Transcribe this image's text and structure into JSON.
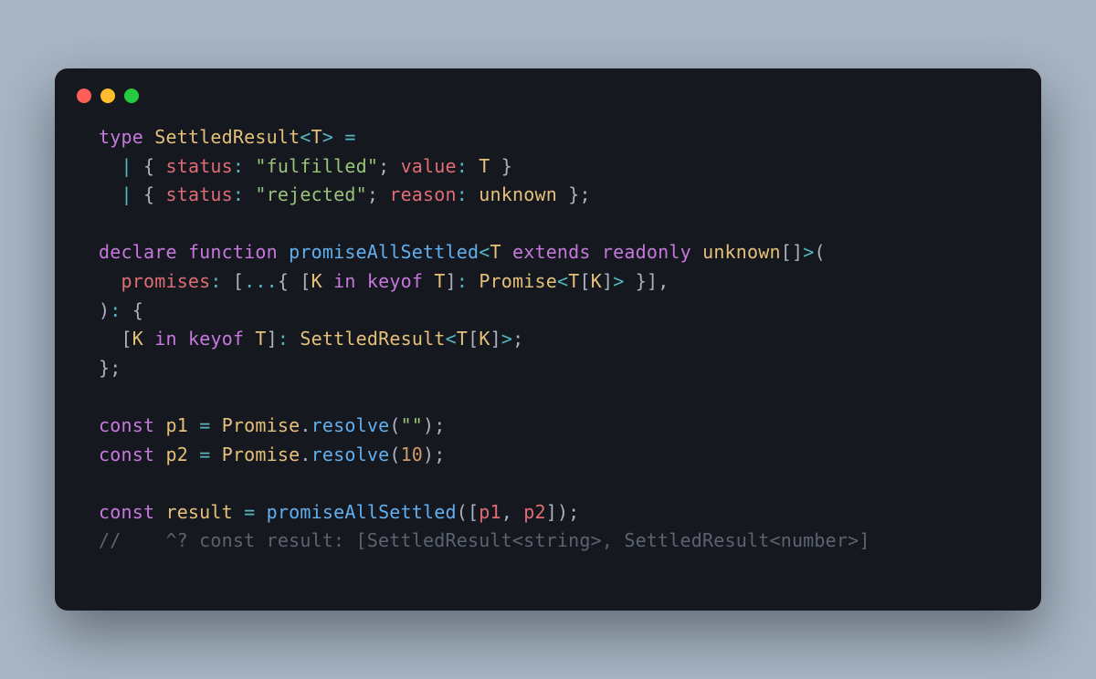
{
  "colors": {
    "page_bg": "#a7b5c4",
    "window_bg": "#15181e",
    "red": "#ff5f56",
    "yellow": "#ffbd2e",
    "green": "#27c93f",
    "default": "#abb2bf",
    "keyword": "#c678dd",
    "type": "#e5c07b",
    "property": "#e06c75",
    "string": "#98c379",
    "function": "#61afef",
    "operator": "#56b6c2",
    "number": "#d19a66",
    "comment": "#5c6370"
  },
  "code_lines": [
    [
      {
        "t": "type ",
        "c": "kw"
      },
      {
        "t": "SettledResult",
        "c": "type"
      },
      {
        "t": "<",
        "c": "op"
      },
      {
        "t": "T",
        "c": "type"
      },
      {
        "t": ">",
        "c": "op"
      },
      {
        "t": " ",
        "c": "punct"
      },
      {
        "t": "=",
        "c": "op"
      }
    ],
    [
      {
        "t": "  ",
        "c": "punct"
      },
      {
        "t": "|",
        "c": "op"
      },
      {
        "t": " { ",
        "c": "punct"
      },
      {
        "t": "status",
        "c": "prop"
      },
      {
        "t": ":",
        "c": "op"
      },
      {
        "t": " ",
        "c": "punct"
      },
      {
        "t": "\"fulfilled\"",
        "c": "str"
      },
      {
        "t": "; ",
        "c": "punct"
      },
      {
        "t": "value",
        "c": "prop"
      },
      {
        "t": ":",
        "c": "op"
      },
      {
        "t": " ",
        "c": "punct"
      },
      {
        "t": "T",
        "c": "type"
      },
      {
        "t": " }",
        "c": "punct"
      }
    ],
    [
      {
        "t": "  ",
        "c": "punct"
      },
      {
        "t": "|",
        "c": "op"
      },
      {
        "t": " { ",
        "c": "punct"
      },
      {
        "t": "status",
        "c": "prop"
      },
      {
        "t": ":",
        "c": "op"
      },
      {
        "t": " ",
        "c": "punct"
      },
      {
        "t": "\"rejected\"",
        "c": "str"
      },
      {
        "t": "; ",
        "c": "punct"
      },
      {
        "t": "reason",
        "c": "prop"
      },
      {
        "t": ":",
        "c": "op"
      },
      {
        "t": " ",
        "c": "punct"
      },
      {
        "t": "unknown",
        "c": "type"
      },
      {
        "t": " };",
        "c": "punct"
      }
    ],
    [],
    [
      {
        "t": "declare ",
        "c": "kw"
      },
      {
        "t": "function ",
        "c": "kw"
      },
      {
        "t": "promiseAllSettled",
        "c": "fn"
      },
      {
        "t": "<",
        "c": "op"
      },
      {
        "t": "T",
        "c": "type"
      },
      {
        "t": " ",
        "c": "punct"
      },
      {
        "t": "extends ",
        "c": "kw"
      },
      {
        "t": "readonly ",
        "c": "kw"
      },
      {
        "t": "unknown",
        "c": "type"
      },
      {
        "t": "[]",
        "c": "punct"
      },
      {
        "t": ">",
        "c": "op"
      },
      {
        "t": "(",
        "c": "punct"
      }
    ],
    [
      {
        "t": "  ",
        "c": "punct"
      },
      {
        "t": "promises",
        "c": "prop"
      },
      {
        "t": ":",
        "c": "op"
      },
      {
        "t": " [",
        "c": "punct"
      },
      {
        "t": "...",
        "c": "op"
      },
      {
        "t": "{ [",
        "c": "punct"
      },
      {
        "t": "K",
        "c": "type"
      },
      {
        "t": " ",
        "c": "punct"
      },
      {
        "t": "in ",
        "c": "kw"
      },
      {
        "t": "keyof ",
        "c": "kw"
      },
      {
        "t": "T",
        "c": "type"
      },
      {
        "t": "]",
        "c": "punct"
      },
      {
        "t": ":",
        "c": "op"
      },
      {
        "t": " ",
        "c": "punct"
      },
      {
        "t": "Promise",
        "c": "type"
      },
      {
        "t": "<",
        "c": "op"
      },
      {
        "t": "T",
        "c": "type"
      },
      {
        "t": "[",
        "c": "punct"
      },
      {
        "t": "K",
        "c": "type"
      },
      {
        "t": "]",
        "c": "punct"
      },
      {
        "t": ">",
        "c": "op"
      },
      {
        "t": " }],",
        "c": "punct"
      }
    ],
    [
      {
        "t": ")",
        "c": "punct"
      },
      {
        "t": ":",
        "c": "op"
      },
      {
        "t": " {",
        "c": "punct"
      }
    ],
    [
      {
        "t": "  [",
        "c": "punct"
      },
      {
        "t": "K",
        "c": "type"
      },
      {
        "t": " ",
        "c": "punct"
      },
      {
        "t": "in ",
        "c": "kw"
      },
      {
        "t": "keyof ",
        "c": "kw"
      },
      {
        "t": "T",
        "c": "type"
      },
      {
        "t": "]",
        "c": "punct"
      },
      {
        "t": ":",
        "c": "op"
      },
      {
        "t": " ",
        "c": "punct"
      },
      {
        "t": "SettledResult",
        "c": "type"
      },
      {
        "t": "<",
        "c": "op"
      },
      {
        "t": "T",
        "c": "type"
      },
      {
        "t": "[",
        "c": "punct"
      },
      {
        "t": "K",
        "c": "type"
      },
      {
        "t": "]",
        "c": "punct"
      },
      {
        "t": ">",
        "c": "op"
      },
      {
        "t": ";",
        "c": "punct"
      }
    ],
    [
      {
        "t": "};",
        "c": "punct"
      }
    ],
    [],
    [
      {
        "t": "const ",
        "c": "kw"
      },
      {
        "t": "p1",
        "c": "var"
      },
      {
        "t": " ",
        "c": "punct"
      },
      {
        "t": "=",
        "c": "op"
      },
      {
        "t": " ",
        "c": "punct"
      },
      {
        "t": "Promise",
        "c": "type"
      },
      {
        "t": ".",
        "c": "punct"
      },
      {
        "t": "resolve",
        "c": "fn"
      },
      {
        "t": "(",
        "c": "punct"
      },
      {
        "t": "\"\"",
        "c": "str"
      },
      {
        "t": ");",
        "c": "punct"
      }
    ],
    [
      {
        "t": "const ",
        "c": "kw"
      },
      {
        "t": "p2",
        "c": "var"
      },
      {
        "t": " ",
        "c": "punct"
      },
      {
        "t": "=",
        "c": "op"
      },
      {
        "t": " ",
        "c": "punct"
      },
      {
        "t": "Promise",
        "c": "type"
      },
      {
        "t": ".",
        "c": "punct"
      },
      {
        "t": "resolve",
        "c": "fn"
      },
      {
        "t": "(",
        "c": "punct"
      },
      {
        "t": "10",
        "c": "num"
      },
      {
        "t": ");",
        "c": "punct"
      }
    ],
    [],
    [
      {
        "t": "const ",
        "c": "kw"
      },
      {
        "t": "result",
        "c": "var"
      },
      {
        "t": " ",
        "c": "punct"
      },
      {
        "t": "=",
        "c": "op"
      },
      {
        "t": " ",
        "c": "punct"
      },
      {
        "t": "promiseAllSettled",
        "c": "fn"
      },
      {
        "t": "([",
        "c": "punct"
      },
      {
        "t": "p1",
        "c": "varref"
      },
      {
        "t": ", ",
        "c": "punct"
      },
      {
        "t": "p2",
        "c": "varref"
      },
      {
        "t": "]);",
        "c": "punct"
      }
    ],
    [
      {
        "t": "//    ^? const result: [SettledResult<string>, SettledResult<number>]",
        "c": "comment"
      }
    ]
  ]
}
